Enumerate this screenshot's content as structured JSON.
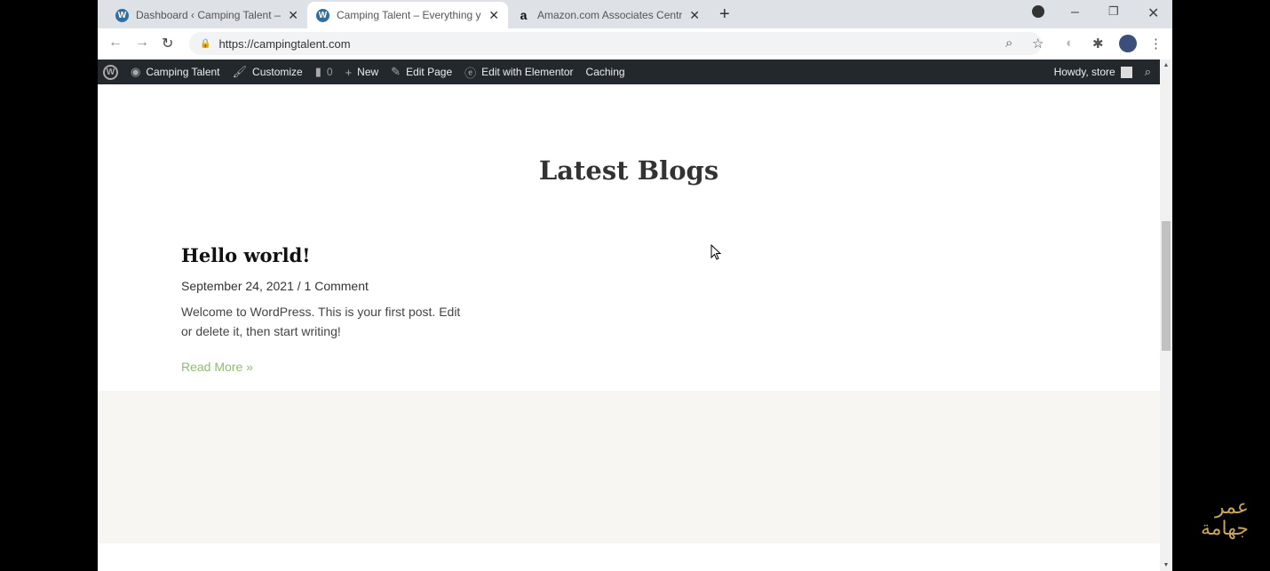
{
  "browser": {
    "tabs": [
      {
        "title": "Dashboard ‹ Camping Talent — W",
        "icon": "wordpress-icon",
        "active": false
      },
      {
        "title": "Camping Talent – Everything you",
        "icon": "wordpress-icon",
        "active": true
      },
      {
        "title": "Amazon.com Associates Central",
        "icon": "amazon-icon",
        "active": false
      }
    ],
    "url": "https://campingtalent.com"
  },
  "admin_bar": {
    "items": [
      "Camping Talent",
      "Customize",
      "0",
      "New",
      "Edit Page",
      "Edit with Elementor",
      "Caching"
    ],
    "howdy": "Howdy, store"
  },
  "section": {
    "title": "Latest Blogs"
  },
  "post": {
    "title": "Hello world!",
    "meta": "September 24, 2021 / 1 Comment",
    "excerpt": "Welcome to WordPress. This is your first post. Edit or delete it, then start writing!",
    "read_more": "Read More »"
  },
  "watermark": {
    "line1": "عمر",
    "line2": "جهامة"
  },
  "colors": {
    "admin_bar": "#23282d",
    "read_more": "#8cbf6a",
    "footer_band": "#f7f6f2"
  }
}
